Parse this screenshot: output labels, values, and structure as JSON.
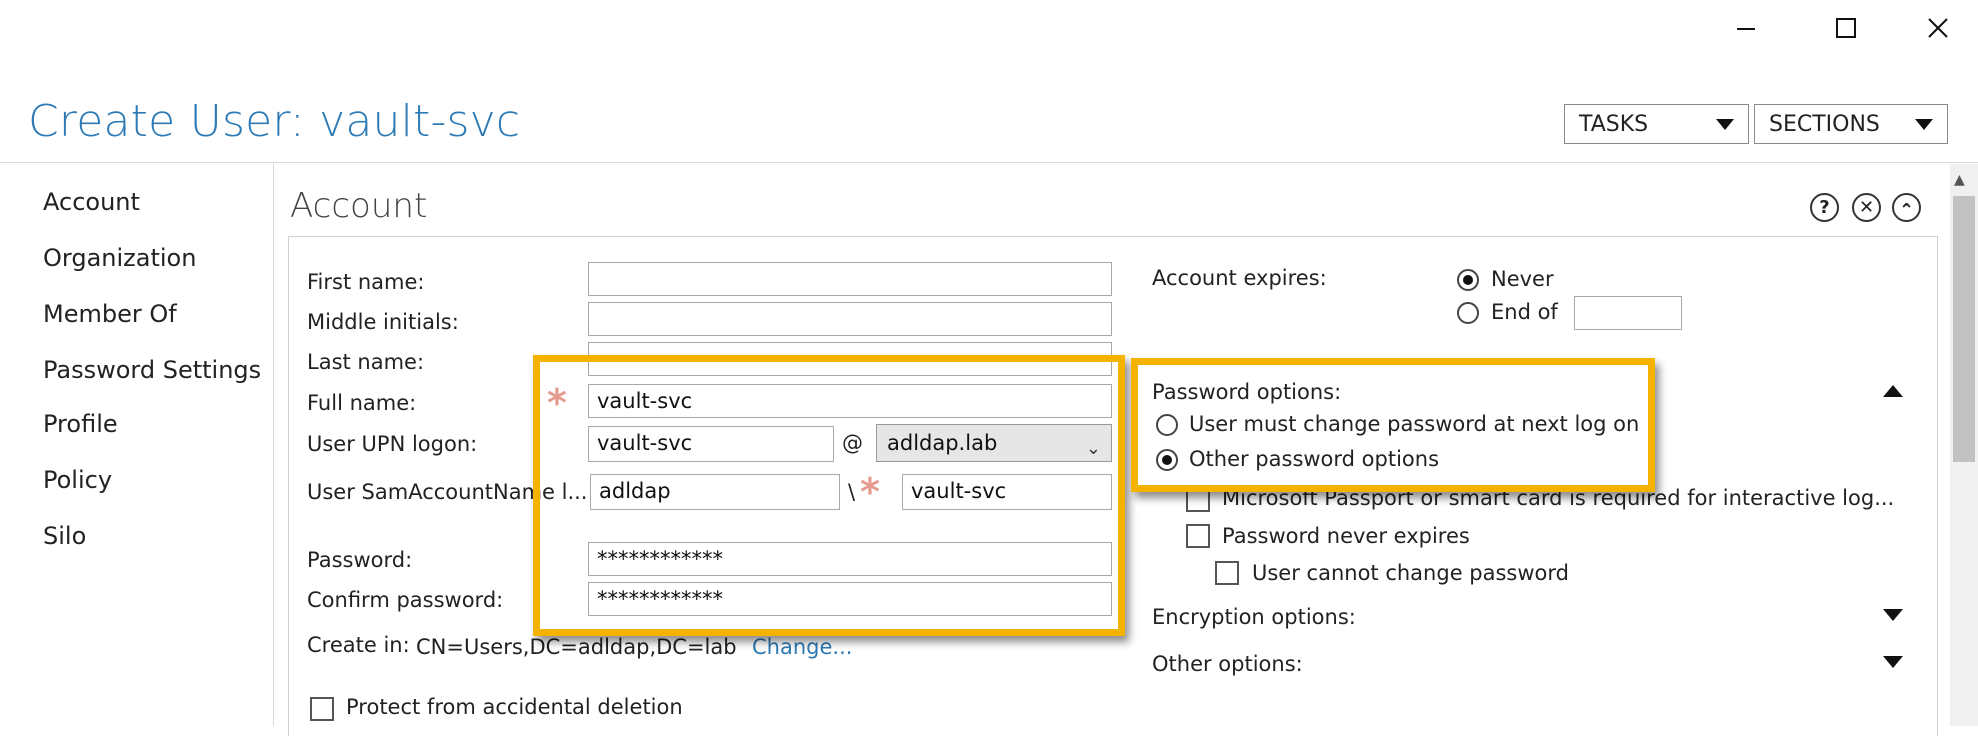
{
  "window": {
    "minimize_icon": "minimize-icon",
    "maximize_icon": "maximize-icon",
    "close_icon": "close-icon"
  },
  "header": {
    "title": "Create User: vault-svc",
    "tasks_label": "TASKS",
    "sections_label": "SECTIONS"
  },
  "nav": {
    "items": [
      {
        "label": "Account"
      },
      {
        "label": "Organization"
      },
      {
        "label": "Member Of"
      },
      {
        "label": "Password Settings"
      },
      {
        "label": "Profile"
      },
      {
        "label": "Policy"
      },
      {
        "label": "Silo"
      }
    ]
  },
  "section": {
    "title": "Account",
    "help_icon": "?",
    "close_icon": "✕",
    "collapse_icon": "⌃"
  },
  "form": {
    "first_name_label": "First name:",
    "first_name_value": "",
    "middle_initials_label": "Middle initials:",
    "middle_initials_value": "",
    "last_name_label": "Last name:",
    "last_name_value": "",
    "full_name_label": "Full name:",
    "full_name_value": "vault-svc",
    "upn_label": "User UPN logon:",
    "upn_value": "vault-svc",
    "upn_at": "@",
    "upn_domain": "adldap.lab",
    "sam_label": "User SamAccountName l...",
    "sam_domain_value": "adldap",
    "sam_separator": "\\",
    "sam_value": "vault-svc",
    "password_label": "Password:",
    "password_value": "************",
    "confirm_label": "Confirm password:",
    "confirm_value": "************",
    "create_in_label": "Create in:",
    "create_in_value": "CN=Users,DC=adldap,DC=lab",
    "change_link": "Change...",
    "protect_label": "Protect from accidental deletion"
  },
  "right": {
    "account_expires_label": "Account expires:",
    "never_label": "Never",
    "end_of_label": "End of",
    "end_of_value": "",
    "password_options_label": "Password options:",
    "must_change_label": "User must change password at next log on",
    "other_password_label": "Other password options",
    "smart_card_label": "Microsoft Passport or smart card is required for interactive log...",
    "never_expires_label": "Password never expires",
    "cannot_change_label": "User cannot change password",
    "encryption_label": "Encryption options:",
    "other_options_label": "Other options:"
  },
  "colors": {
    "accent": "#2d7ab5",
    "highlight": "#f5b301",
    "required": "#e49a8d"
  }
}
